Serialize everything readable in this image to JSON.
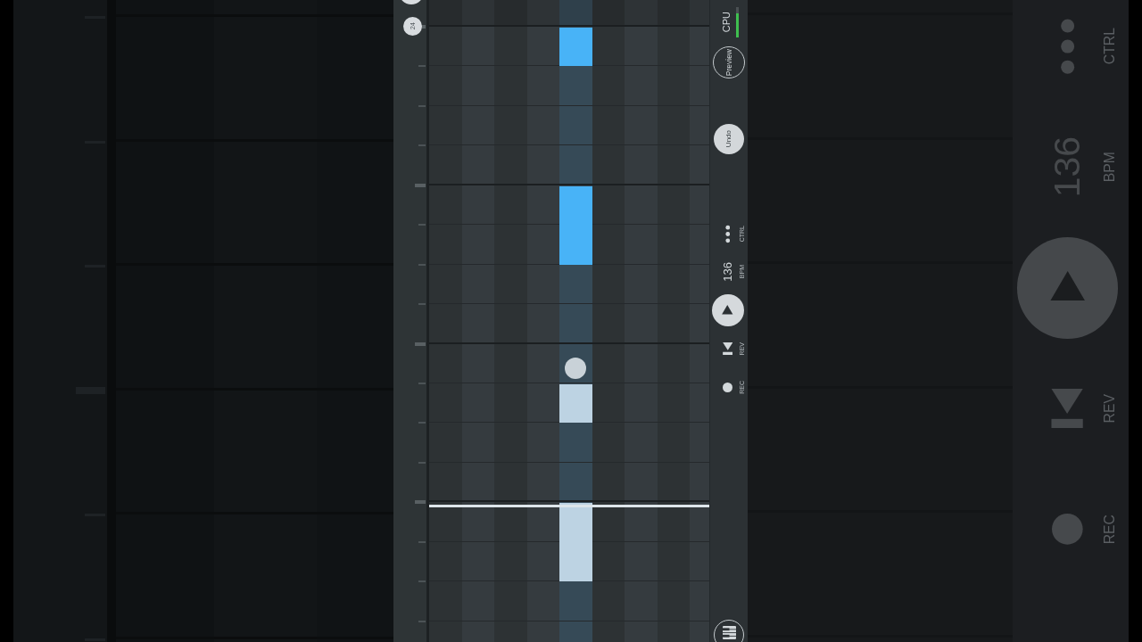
{
  "ruler": {
    "button_label": "24"
  },
  "grid": {
    "lanes": [
      {
        "kind": "dark",
        "selected": false
      },
      {
        "kind": "light",
        "selected": false
      },
      {
        "kind": "dark",
        "selected": false
      },
      {
        "kind": "light",
        "selected": false
      },
      {
        "kind": "light",
        "selected": true,
        "steps": [
          {
            "kind": "empty"
          },
          {
            "kind": "note",
            "selected": false
          },
          {
            "kind": "empty"
          },
          {
            "kind": "empty"
          },
          {
            "kind": "empty"
          },
          {
            "kind": "note",
            "selected": false
          },
          {
            "kind": "hold",
            "selected": false
          },
          {
            "kind": "empty"
          },
          {
            "kind": "empty"
          },
          {
            "kind": "handle"
          },
          {
            "kind": "note",
            "selected": true
          },
          {
            "kind": "empty"
          },
          {
            "kind": "empty"
          },
          {
            "kind": "note",
            "selected": true
          },
          {
            "kind": "hold",
            "selected": true
          },
          {
            "kind": "empty"
          },
          {
            "kind": "empty"
          }
        ]
      },
      {
        "kind": "dark",
        "selected": false
      },
      {
        "kind": "light",
        "selected": false
      },
      {
        "kind": "dark",
        "selected": false
      },
      {
        "kind": "light",
        "selected": false
      }
    ],
    "rows": [
      {
        "playhead": false
      },
      {
        "playhead": false
      },
      {
        "playhead": false
      },
      {
        "playhead": false
      },
      {
        "playhead": false
      },
      {
        "playhead": false
      },
      {
        "playhead": false
      },
      {
        "playhead": false
      },
      {
        "playhead": false
      },
      {
        "playhead": false
      },
      {
        "playhead": false
      },
      {
        "playhead": false
      },
      {
        "playhead": false
      },
      {
        "playhead": true
      },
      {
        "playhead": false
      },
      {
        "playhead": false
      },
      {
        "playhead": false
      }
    ]
  },
  "side_panel": {
    "cpu": {
      "label": "CPU",
      "level": 0.8
    },
    "buttons": [
      {
        "kind": "outline",
        "label": "Preview"
      },
      {
        "kind": "filled",
        "label": "Undo"
      }
    ],
    "controls": [
      {
        "kind": "menu",
        "label": "CTRL"
      },
      {
        "kind": "tempo",
        "value": "136",
        "label": "BPM"
      },
      {
        "kind": "play"
      },
      {
        "kind": "reverse",
        "label": "REV"
      },
      {
        "kind": "record",
        "label": "REC"
      }
    ]
  },
  "backdrop": {
    "controls": [
      {
        "kind": "menu",
        "label": "CTRL"
      },
      {
        "kind": "tempo",
        "value": "136",
        "label": "BPM"
      },
      {
        "kind": "play"
      },
      {
        "kind": "reverse",
        "label": "REV"
      },
      {
        "kind": "record",
        "label": "REC"
      }
    ]
  }
}
